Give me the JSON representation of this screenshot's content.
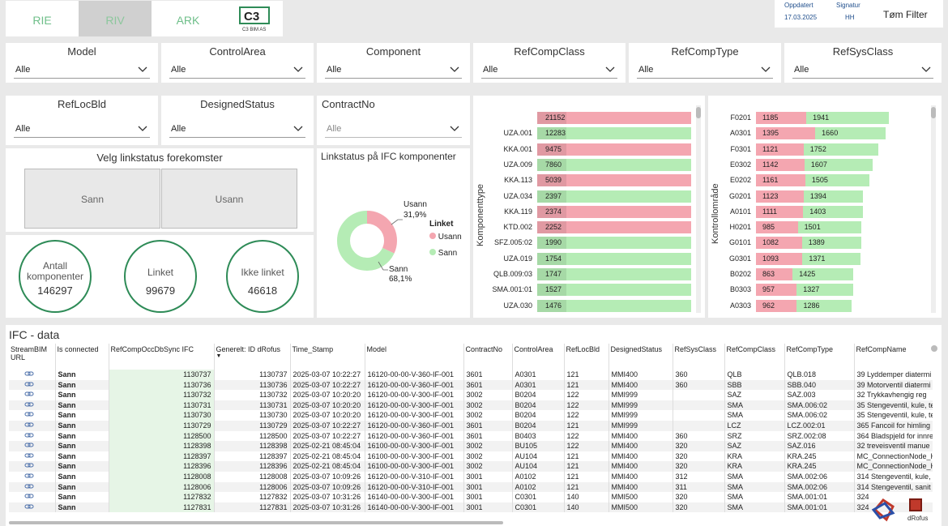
{
  "tabs": [
    {
      "label": "RIE",
      "active": false
    },
    {
      "label": "RIV",
      "active": true
    },
    {
      "label": "ARK",
      "active": false
    }
  ],
  "logo": {
    "text": "C3",
    "subtitle": "C3 BIM AS"
  },
  "header": {
    "updated_label": "Oppdatert",
    "updated_value": "17.03.2025",
    "signature_label": "Signatur",
    "signature_value": "HH",
    "clear_filter": "Tøm Filter"
  },
  "slicers": [
    {
      "title": "Model",
      "value": "Alle"
    },
    {
      "title": "ControlArea",
      "value": "Alle"
    },
    {
      "title": "Component",
      "value": "Alle"
    },
    {
      "title": "RefCompClass",
      "value": "Alle"
    },
    {
      "title": "RefCompType",
      "value": "Alle"
    },
    {
      "title": "RefSysClass",
      "value": "Alle"
    },
    {
      "title": "RefLocBld",
      "value": "Alle"
    },
    {
      "title": "DesignedStatus",
      "value": "Alle"
    },
    {
      "title": "ContractNo",
      "value": "Alle"
    }
  ],
  "linkstatus_selector": {
    "title": "Velg linkstatus forekomster",
    "option_true": "Sann",
    "option_false": "Usann"
  },
  "kpis": {
    "total_label": "Antall komponenter",
    "total_value": "146297",
    "linked_label": "Linket",
    "linked_value": "99679",
    "not_linked_label": "Ikke linket",
    "not_linked_value": "46618"
  },
  "donut": {
    "title": "Linkstatus på IFC komponenter",
    "legend_title": "Linket",
    "usann_label": "Usann",
    "usann_pct": "31,9%",
    "sann_label": "Sann",
    "sann_pct": "68,1%",
    "usann_value": 31.9,
    "sann_value": 68.1,
    "usann_color": "#f4a6b0",
    "sann_color": "#b5ecb5"
  },
  "chart_data": [
    {
      "type": "bar",
      "orientation": "horizontal",
      "ylabel": "Komponenttype",
      "categories": [
        "",
        "UZA.001",
        "KKA.001",
        "UZA.009",
        "KKA.113",
        "UZA.034",
        "KKA.119",
        "KTD.002",
        "SFZ.005:02",
        "UZA.019",
        "QLB.009:03",
        "SMA.001:01",
        "UZA.030"
      ],
      "values": [
        21152,
        12283,
        9475,
        7860,
        5039,
        2397,
        2374,
        2252,
        1990,
        1754,
        1747,
        1527,
        1476
      ],
      "status": [
        "Usann",
        "Sann",
        "Usann",
        "Sann",
        "Usann",
        "Sann",
        "Usann",
        "Usann",
        "Sann",
        "Sann",
        "Sann",
        "Sann",
        "Sann"
      ],
      "colors": {
        "Usann": "#f4a6b0",
        "Sann": "#b5ecb5"
      }
    },
    {
      "type": "bar",
      "orientation": "horizontal",
      "stacked": true,
      "ylabel": "Kontrollområde",
      "categories": [
        "F0201",
        "A0301",
        "F0301",
        "E0302",
        "E0202",
        "G0201",
        "A0101",
        "H0201",
        "G0101",
        "G0301",
        "B0202",
        "B0303",
        "A0303"
      ],
      "series": [
        {
          "name": "Usann",
          "values": [
            1185,
            1395,
            1121,
            1142,
            1161,
            1123,
            1111,
            985,
            1082,
            1093,
            863,
            957,
            962
          ]
        },
        {
          "name": "Sann",
          "values": [
            1941,
            1660,
            1752,
            1607,
            1505,
            1394,
            1403,
            1501,
            1389,
            1371,
            1425,
            1327,
            1286
          ]
        }
      ],
      "colors": {
        "Usann": "#f4a6b0",
        "Sann": "#b5ecb5"
      }
    }
  ],
  "ifc_table": {
    "title": "IFC - data",
    "sort_indicator": "▼",
    "columns": [
      "StreamBIM URL",
      "Is connected",
      "RefCompOccDbSync IFC",
      "Generelt: ID dRofus",
      "Time_Stamp",
      "Model",
      "ContractNo",
      "ControlArea",
      "RefLocBld",
      "DesignedStatus",
      "RefSysClass",
      "RefCompClass",
      "RefCompType",
      "RefCompName"
    ],
    "rows": [
      [
        "",
        "Sann",
        "1130737",
        "1130737",
        "2025-03-07 10:22:27",
        "16120-00-00-V-360-IF-001",
        "3601",
        "A0301",
        "121",
        "MMI400",
        "360",
        "QLB",
        "QLB.018",
        "39 Lyddemper diatermi"
      ],
      [
        "",
        "Sann",
        "1130736",
        "1130736",
        "2025-03-07 10:22:27",
        "16120-00-00-V-360-IF-001",
        "3601",
        "A0301",
        "121",
        "MMI400",
        "360",
        "SBB",
        "SBB.040",
        "39 Motorventil diatermi"
      ],
      [
        "",
        "Sann",
        "1130732",
        "1130732",
        "2025-03-07 10:20:20",
        "16120-00-00-V-300-IF-001",
        "3002",
        "B0204",
        "122",
        "MMI999",
        "",
        "SAZ",
        "SAZ.003",
        "32 Trykkavhengig reg"
      ],
      [
        "",
        "Sann",
        "1130731",
        "1130731",
        "2025-03-07 10:20:20",
        "16120-00-00-V-300-IF-001",
        "3002",
        "B0204",
        "122",
        "MMI999",
        "",
        "SMA",
        "SMA.006:02",
        "35 Stengeventil, kule, te"
      ],
      [
        "",
        "Sann",
        "1130730",
        "1130730",
        "2025-03-07 10:20:20",
        "16120-00-00-V-300-IF-001",
        "3002",
        "B0204",
        "122",
        "MMI999",
        "",
        "SMA",
        "SMA.006:02",
        "35 Stengeventil, kule, te"
      ],
      [
        "",
        "Sann",
        "1130729",
        "1130729",
        "2025-03-07 10:22:27",
        "16120-00-00-V-360-IF-001",
        "3601",
        "B0204",
        "121",
        "MMI999",
        "",
        "LCZ",
        "LCZ.002:01",
        "365 Fancoil for himling"
      ],
      [
        "",
        "Sann",
        "1128500",
        "1128500",
        "2025-03-07 10:22:27",
        "16120-00-00-V-360-IF-001",
        "3601",
        "B0403",
        "122",
        "MMI400",
        "360",
        "SRZ",
        "SRZ.002:08",
        "364 Bladspjeld for innre"
      ],
      [
        "",
        "Sann",
        "1128398",
        "1128398",
        "2025-02-21 08:45:04",
        "16100-00-00-V-300-IF-001",
        "3002",
        "BU105",
        "122",
        "MMI400",
        "320",
        "SAZ",
        "SAZ.016",
        "32 treveisventil manue"
      ],
      [
        "",
        "Sann",
        "1128397",
        "1128397",
        "2025-02-21 08:45:04",
        "16100-00-00-V-300-IF-001",
        "3002",
        "AU104",
        "121",
        "MMI400",
        "320",
        "KRA",
        "KRA.245",
        "MC_ConnectionNode_H"
      ],
      [
        "",
        "Sann",
        "1128396",
        "1128396",
        "2025-02-21 08:45:04",
        "16100-00-00-V-300-IF-001",
        "3002",
        "AU104",
        "121",
        "MMI400",
        "320",
        "KRA",
        "KRA.245",
        "MC_ConnectionNode_H"
      ],
      [
        "",
        "Sann",
        "1128008",
        "1128008",
        "2025-03-07 10:09:26",
        "16120-00-00-V-310-IF-001",
        "3001",
        "A0102",
        "121",
        "MMI400",
        "312",
        "SMA",
        "SMA.002:06",
        "314 Stengeventil, kule,"
      ],
      [
        "",
        "Sann",
        "1128006",
        "1128006",
        "2025-03-07 10:09:26",
        "16120-00-00-V-310-IF-001",
        "3001",
        "A0102",
        "121",
        "MMI400",
        "311",
        "SMA",
        "SMA.002:06",
        "314 Stengeventil, sanit"
      ],
      [
        "",
        "Sann",
        "1127832",
        "1127832",
        "2025-03-07 10:31:26",
        "16140-00-00-V-300-IF-001",
        "3001",
        "C0301",
        "140",
        "MMI500",
        "320",
        "SMA",
        "SMA.001:01",
        "324"
      ],
      [
        "",
        "Sann",
        "1127831",
        "1127831",
        "2025-03-07 10:31:26",
        "16140-00-00-V-300-IF-001",
        "3001",
        "C0301",
        "140",
        "MMI500",
        "320",
        "SMA",
        "SMA.001:01",
        "324"
      ]
    ]
  },
  "footer": {
    "drofus_label": "dRofus"
  }
}
